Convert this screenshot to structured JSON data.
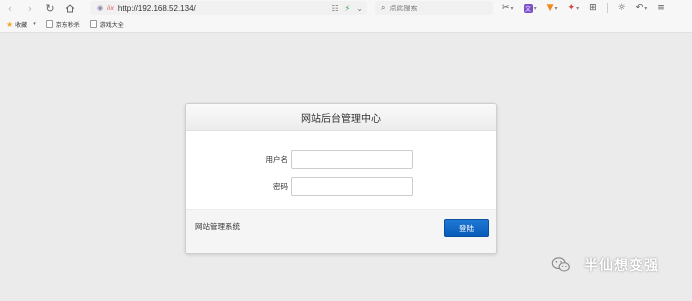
{
  "browser": {
    "url": "http://192.168.52.134/",
    "url_badge": "iix",
    "search_placeholder": "点此搜索"
  },
  "bookmarks": [
    {
      "label": "收藏",
      "type": "favorites"
    },
    {
      "label": "京东秒杀",
      "type": "page"
    },
    {
      "label": "游戏大全",
      "type": "page"
    }
  ],
  "login": {
    "title": "网站后台管理中心",
    "username_label": "用户名",
    "username_value": "",
    "password_label": "密码",
    "password_value": "",
    "footer_text": "网站管理系统",
    "login_button": "登陆"
  },
  "watermark": {
    "text": "半仙想变强"
  },
  "colors": {
    "page_background": "#ebebeb",
    "primary_button": "#0a5cb8",
    "panel_header": "#f0f0f0"
  }
}
